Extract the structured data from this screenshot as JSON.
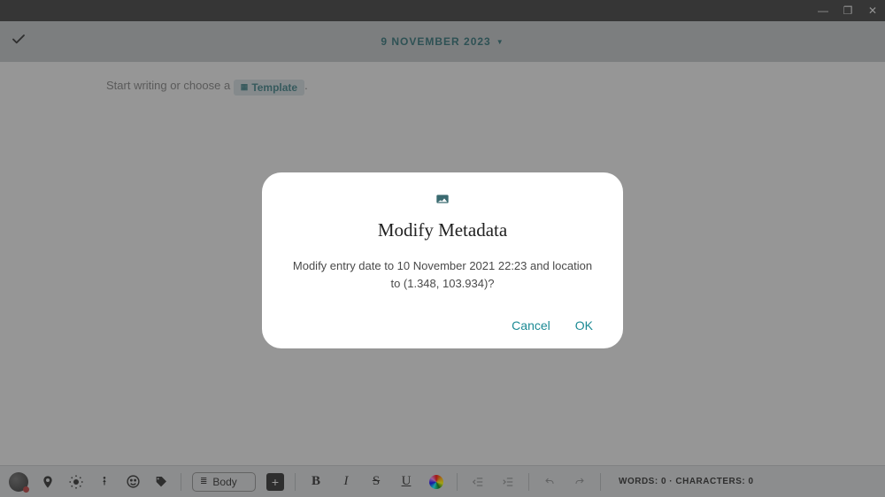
{
  "titlebar": {
    "minimize": "—",
    "restore": "❐",
    "close": "✕"
  },
  "header": {
    "date_label": "9 NOVEMBER 2023"
  },
  "editor": {
    "placeholder_prefix": "Start writing or choose a ",
    "template_chip_label": "Template",
    "placeholder_suffix": "."
  },
  "modal": {
    "title": "Modify Metadata",
    "body": "Modify entry date to 10 November 2021 22:23 and location to (1.348, 103.934)?",
    "cancel_label": "Cancel",
    "ok_label": "OK"
  },
  "toolbar": {
    "style_label": "Body",
    "bold": "B",
    "italic": "I",
    "strike": "S",
    "underline": "U",
    "stats_label": "WORDS: 0 · CHARACTERS: 0"
  }
}
